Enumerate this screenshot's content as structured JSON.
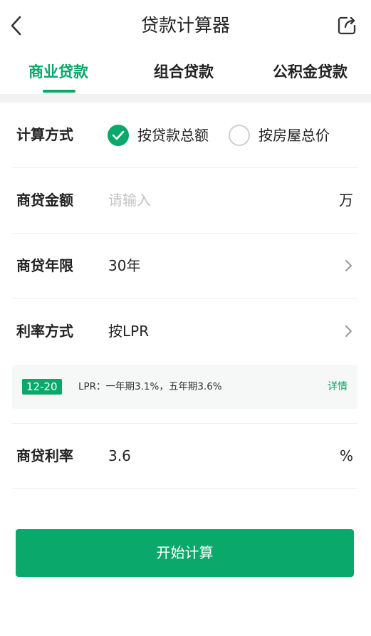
{
  "header": {
    "title": "贷款计算器"
  },
  "tabs": [
    {
      "label": "商业贷款",
      "active": true
    },
    {
      "label": "组合贷款",
      "active": false
    },
    {
      "label": "公积金贷款",
      "active": false
    }
  ],
  "form": {
    "calc_method": {
      "label": "计算方式",
      "options": [
        {
          "label": "按贷款总额",
          "checked": true
        },
        {
          "label": "按房屋总价",
          "checked": false
        }
      ]
    },
    "loan_amount": {
      "label": "商贷金额",
      "placeholder": "请输入",
      "unit": "万"
    },
    "loan_term": {
      "label": "商贷年限",
      "value": "30年"
    },
    "rate_method": {
      "label": "利率方式",
      "value": "按LPR"
    },
    "lpr_info": {
      "date_tag": "12-20",
      "text": "LPR：一年期3.1%，五年期3.6%",
      "detail_link": "详情"
    },
    "loan_rate": {
      "label": "商贷利率",
      "value": "3.6",
      "unit": "%"
    }
  },
  "actions": {
    "calculate_label": "开始计算"
  },
  "colors": {
    "accent": "#0aa86a",
    "placeholder": "#c3c3c3"
  }
}
